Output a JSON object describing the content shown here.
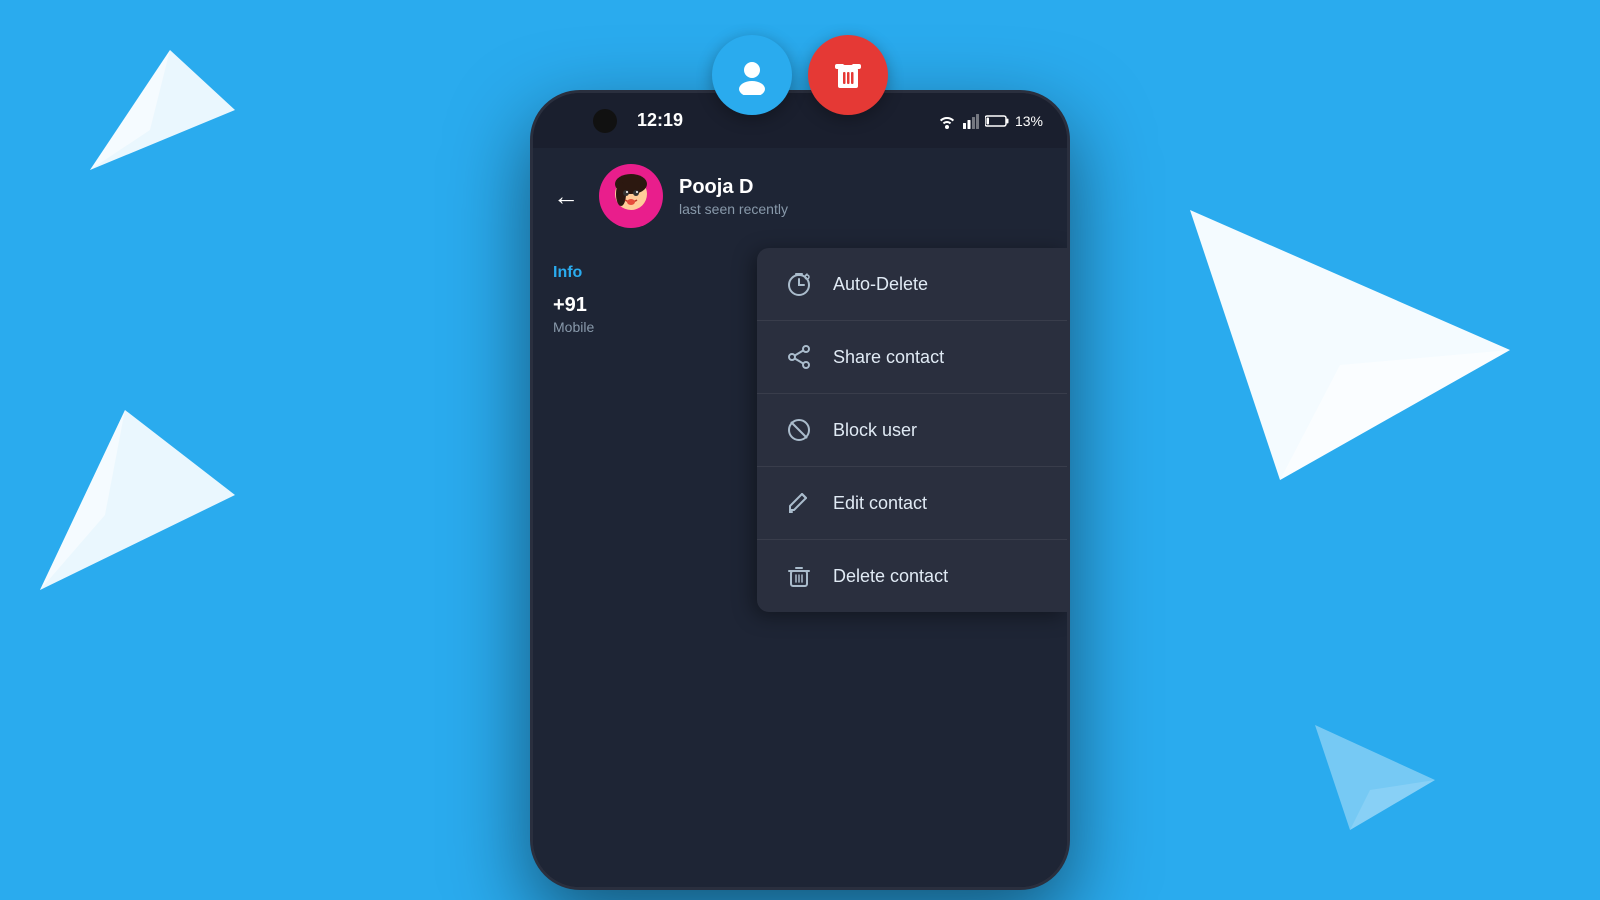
{
  "background": {
    "color": "#2AABEE"
  },
  "fab": {
    "person_icon": "👤",
    "trash_icon": "🗑"
  },
  "status_bar": {
    "time": "12:19",
    "battery": "13%"
  },
  "profile": {
    "name": "Pooja D",
    "status": "last seen recently",
    "phone": "+91",
    "phone_type": "Mobile",
    "info_label": "Info"
  },
  "menu": {
    "items": [
      {
        "id": "auto-delete",
        "icon": "timer",
        "label": "Auto-Delete"
      },
      {
        "id": "share-contact",
        "icon": "share",
        "label": "Share contact"
      },
      {
        "id": "block-user",
        "icon": "block",
        "label": "Block user"
      },
      {
        "id": "edit-contact",
        "icon": "edit",
        "label": "Edit contact"
      },
      {
        "id": "delete-contact",
        "icon": "delete",
        "label": "Delete contact"
      }
    ]
  }
}
